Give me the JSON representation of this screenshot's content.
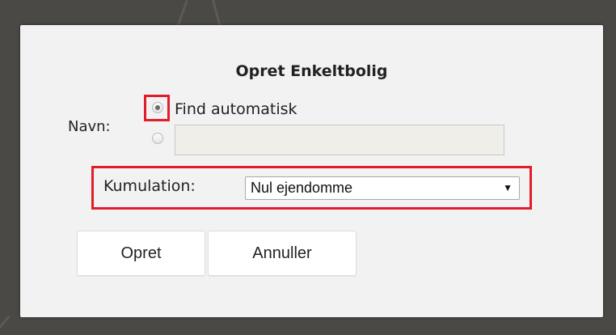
{
  "dialog": {
    "title": "Opret Enkeltbolig",
    "name_label": "Navn:",
    "name_options": {
      "auto_label": "Find automatisk",
      "auto_selected": true,
      "manual_selected": false,
      "manual_value": ""
    },
    "kumulation": {
      "label": "Kumulation:",
      "selected": "Nul ejendomme",
      "arrow_icon": "triangle-down-icon"
    },
    "buttons": {
      "create": "Opret",
      "cancel": "Annuller"
    }
  },
  "colors": {
    "highlight": "#e21d2b",
    "dialog_bg": "#f2f2f2",
    "backdrop": "#4a4946"
  }
}
